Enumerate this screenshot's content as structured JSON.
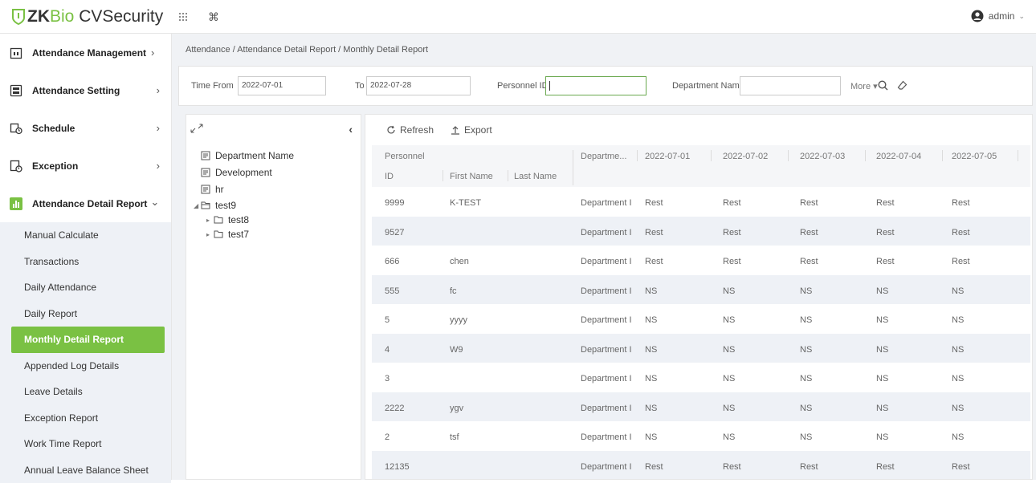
{
  "app": {
    "logo_zk": "ZK",
    "logo_bio": "Bio",
    "logo_cvs": " CVSecurity",
    "user": "admin",
    "accent": "#7ac143"
  },
  "sidebar": {
    "items": [
      {
        "label": "Attendance Management",
        "chevron": "›"
      },
      {
        "label": "Attendance Setting",
        "chevron": "›"
      },
      {
        "label": "Schedule",
        "chevron": "›"
      },
      {
        "label": "Exception",
        "chevron": "›"
      },
      {
        "label": "Attendance Detail Report",
        "chevron": "⌄"
      }
    ],
    "subitems": [
      "Manual Calculate",
      "Transactions",
      "Daily Attendance",
      "Daily Report",
      "Monthly Detail Report",
      "Appended Log Details",
      "Leave Details",
      "Exception Report",
      "Work Time Report",
      "Annual Leave Balance Sheet"
    ]
  },
  "breadcrumb": "Attendance / Attendance Detail Report / Monthly Detail Report",
  "filter": {
    "time_from_label": "Time From",
    "time_from_value": "2022-07-01",
    "to_label": "To",
    "to_value": "2022-07-28",
    "personnel_id_label": "Personnel ID",
    "personnel_id_value": "",
    "department_label": "Department Name",
    "department_value": "",
    "more_label": "More ▾"
  },
  "tree": {
    "nodes": [
      {
        "label": "Department Name"
      },
      {
        "label": "Development"
      },
      {
        "label": "hr"
      },
      {
        "label": "test9"
      },
      {
        "label": "test8"
      },
      {
        "label": "test7"
      }
    ]
  },
  "toolbar": {
    "refresh": "Refresh",
    "export": "Export"
  },
  "table": {
    "group_header": "Personnel",
    "headers": {
      "id": "ID",
      "first_name": "First Name",
      "last_name": "Last Name",
      "department": "Departme...",
      "dates": [
        "2022-07-01",
        "2022-07-02",
        "2022-07-03",
        "2022-07-04",
        "2022-07-05"
      ]
    },
    "rows": [
      {
        "id": "9999",
        "first": "K-TEST",
        "last": "",
        "dept": "Department I",
        "days": [
          "Rest",
          "Rest",
          "Rest",
          "Rest",
          "Rest"
        ]
      },
      {
        "id": "9527",
        "first": "",
        "last": "",
        "dept": "Department I",
        "days": [
          "Rest",
          "Rest",
          "Rest",
          "Rest",
          "Rest"
        ]
      },
      {
        "id": "666",
        "first": "chen",
        "last": "",
        "dept": "Department I",
        "days": [
          "Rest",
          "Rest",
          "Rest",
          "Rest",
          "Rest"
        ]
      },
      {
        "id": "555",
        "first": "fc",
        "last": "",
        "dept": "Department I",
        "days": [
          "NS",
          "NS",
          "NS",
          "NS",
          "NS"
        ]
      },
      {
        "id": "5",
        "first": "yyyy",
        "last": "",
        "dept": "Department I",
        "days": [
          "NS",
          "NS",
          "NS",
          "NS",
          "NS"
        ]
      },
      {
        "id": "4",
        "first": "W9",
        "last": "",
        "dept": "Department I",
        "days": [
          "NS",
          "NS",
          "NS",
          "NS",
          "NS"
        ]
      },
      {
        "id": "3",
        "first": "",
        "last": "",
        "dept": "Department I",
        "days": [
          "NS",
          "NS",
          "NS",
          "NS",
          "NS"
        ]
      },
      {
        "id": "2222",
        "first": "ygv",
        "last": "",
        "dept": "Department I",
        "days": [
          "NS",
          "NS",
          "NS",
          "NS",
          "NS"
        ]
      },
      {
        "id": "2",
        "first": "tsf",
        "last": "",
        "dept": "Department I",
        "days": [
          "NS",
          "NS",
          "NS",
          "NS",
          "NS"
        ]
      },
      {
        "id": "12135",
        "first": "",
        "last": "",
        "dept": "Department I",
        "days": [
          "Rest",
          "Rest",
          "Rest",
          "Rest",
          "Rest"
        ]
      }
    ]
  }
}
